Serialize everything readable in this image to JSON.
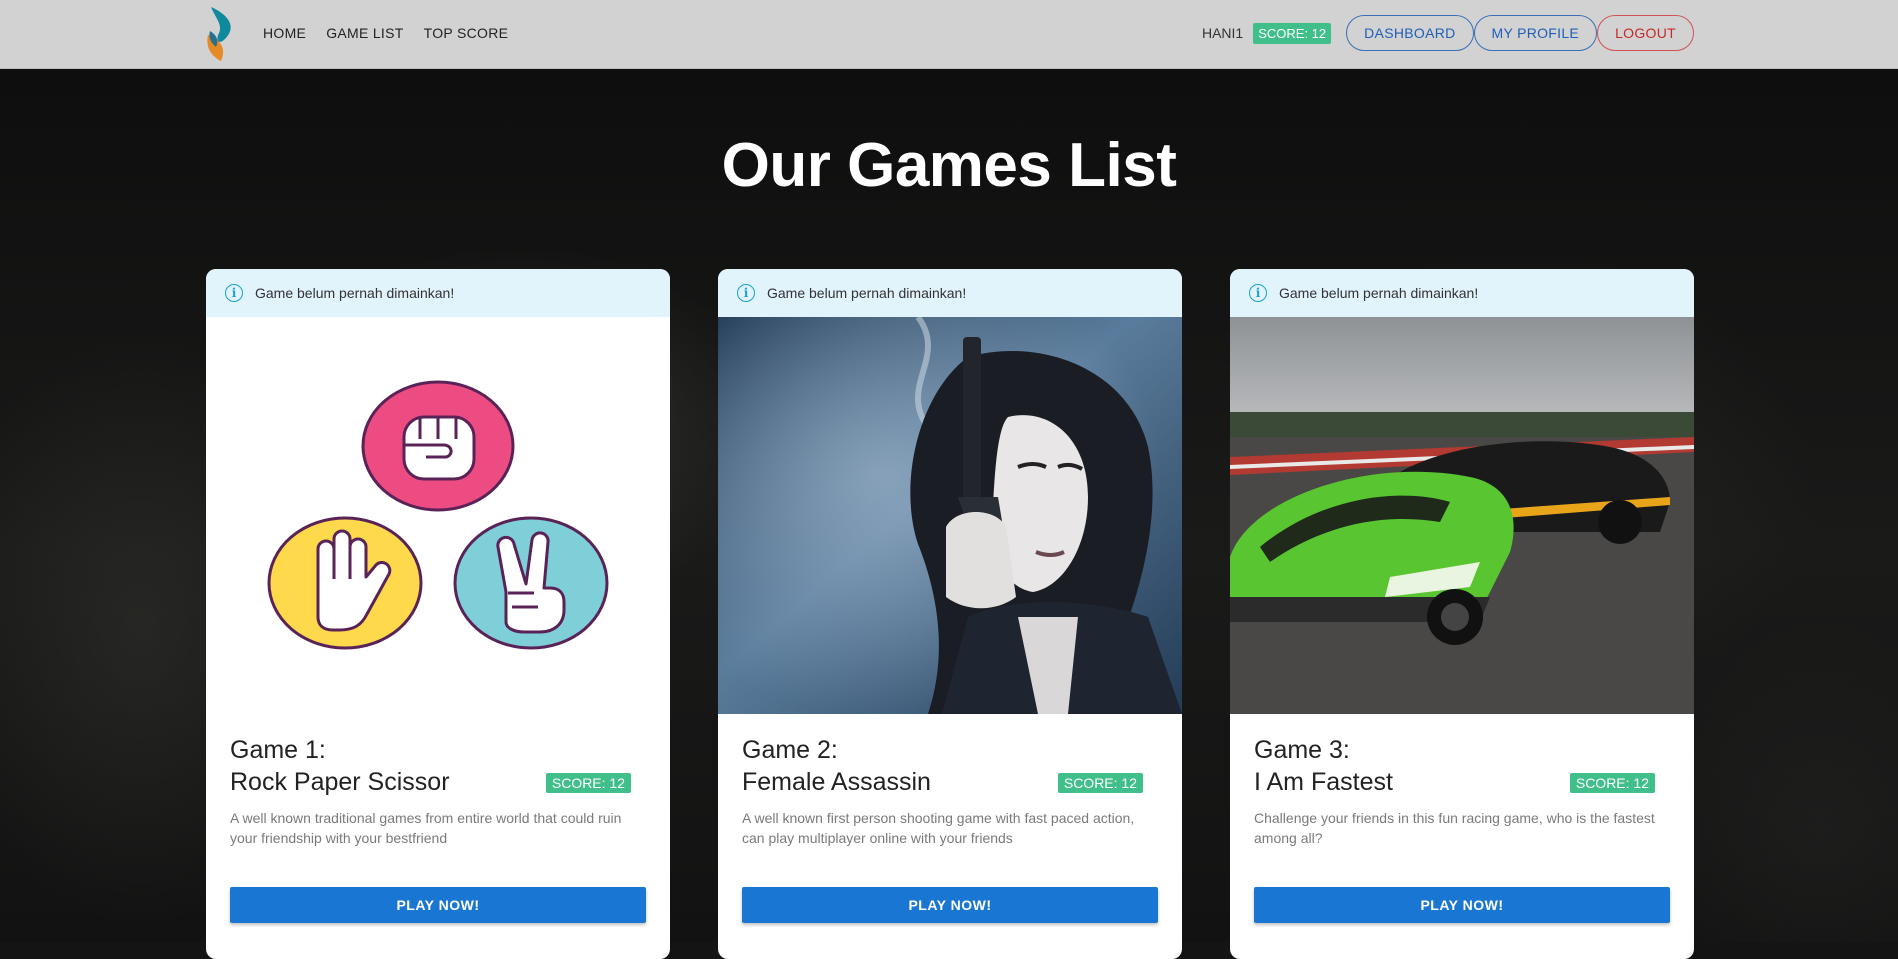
{
  "nav": {
    "links": [
      "HOME",
      "GAME LIST",
      "TOP SCORE"
    ],
    "username": "HANI1",
    "score_badge": "SCORE: 12",
    "dashboard": "DASHBOARD",
    "profile": "MY PROFILE",
    "logout": "LOGOUT"
  },
  "title": "Our Games List",
  "games": [
    {
      "alert": "Game belum pernah dimainkan!",
      "number": "Game 1:",
      "name": "Rock Paper Scissor",
      "score": "SCORE: 12",
      "description": "A well known traditional games from entire world that could ruin your friendship with your bestfriend",
      "button": "PLAY NOW!"
    },
    {
      "alert": "Game belum pernah dimainkan!",
      "number": "Game 2:",
      "name": "Female Assassin",
      "score": "SCORE: 12",
      "description": "A well known first person shooting game with fast paced action, can play multiplayer online with your friends",
      "button": "PLAY NOW!"
    },
    {
      "alert": "Game belum pernah dimainkan!",
      "number": "Game 3:",
      "name": "I Am Fastest",
      "score": "SCORE: 12",
      "description": "Challenge your friends in this fun racing game, who is the fastest among all?",
      "button": "PLAY NOW!"
    }
  ],
  "colors": {
    "primary": "#1976d2",
    "score_green": "#41bf8a",
    "alert_bg": "#e1f3fb",
    "logout_red": "#c62828"
  },
  "icons": [
    "logo-icon",
    "info-icon"
  ]
}
